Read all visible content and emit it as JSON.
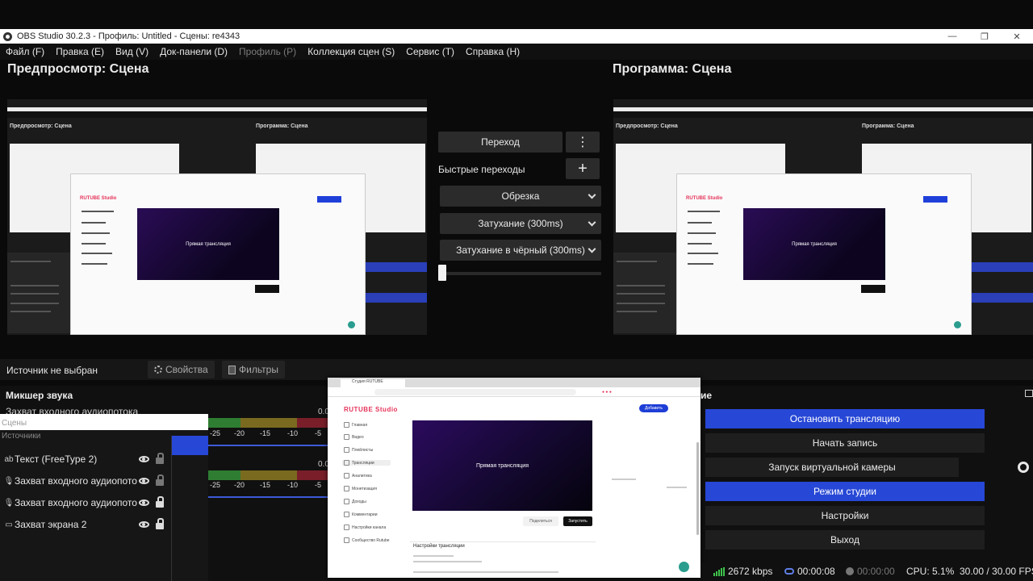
{
  "titlebar": {
    "title": "OBS Studio 30.2.3 - Профиль: Untitled - Сцены: re4343",
    "minimize": "—",
    "maximize": "❐",
    "close": "✕"
  },
  "menu": [
    "Файл (F)",
    "Правка (E)",
    "Вид (V)",
    "Док-панели (D)",
    "Профиль (P)",
    "Коллекция сцен (S)",
    "Сервис (T)",
    "Справка (H)"
  ],
  "preview": {
    "title": "Предпросмотр: Сцена",
    "mini_left_title": "Предпросмотр: Сцена",
    "mini_right_title": "Программа: Сцена",
    "video_text": "Прямая трансляция",
    "brand": "RUTUBE Studio"
  },
  "program": {
    "title": "Программа: Сцена"
  },
  "transitions": {
    "transition_button": "Переход",
    "menu_icon": "⋮",
    "quick_label": "Быстрые переходы",
    "add_icon": "+",
    "items": [
      "Обрезка",
      "Затухание (300ms)",
      "Затухание в чёрный (300ms)"
    ]
  },
  "source_toolbar": {
    "none_selected": "Источник не выбран",
    "properties": "Свойства",
    "filters": "Фильтры"
  },
  "mixer": {
    "title": "Микшер звука",
    "subtitle": "Захват входного аудиопотока",
    "scale": [
      "-25",
      "-20",
      "-15",
      "-10",
      "-5"
    ],
    "level1": "0.0",
    "level2": "0.0"
  },
  "sources": {
    "scenes_label": "Сцены",
    "sources_label": "Источники",
    "items": [
      {
        "icon": "ab",
        "label": "Текст (FreeType 2)"
      },
      {
        "icon": "🎙",
        "label": "Захват входного аудиопотока"
      },
      {
        "icon": "🎙",
        "label": "Захват входного аудиопотока"
      },
      {
        "icon": "▭",
        "label": "Захват экрана 2"
      }
    ]
  },
  "popup": {
    "tab_title": "Студия RUTUBE",
    "brand": "RUTUBE Studio",
    "video_text": "Прямая трансляция",
    "btn_share": "Поделиться",
    "btn_start": "Запустить",
    "btn_add": "Добавить",
    "settings_title": "Настройки трансляции",
    "nav": [
      "Главная",
      "Видео",
      "Плейлисты",
      "Трансляции",
      "Аналитика",
      "Монетизация",
      "Доходы",
      "Комментарии",
      "Настройки канала",
      "Сообщество Rutube"
    ]
  },
  "controls": {
    "header": "ие",
    "buttons": [
      "Остановить трансляцию",
      "Начать запись",
      "Запуск виртуальной камеры",
      "Режим студии",
      "Настройки",
      "Выход"
    ]
  },
  "status": {
    "bitrate": "2672 kbps",
    "stream_time": "00:00:08",
    "rec_time": "00:00:00",
    "cpu": "CPU: 5.1%",
    "fps": "30.00 / 30.00 FPS"
  },
  "colors": {
    "accent": "#2747d6",
    "bg": "#101010",
    "rutube_red": "#e5335a"
  }
}
